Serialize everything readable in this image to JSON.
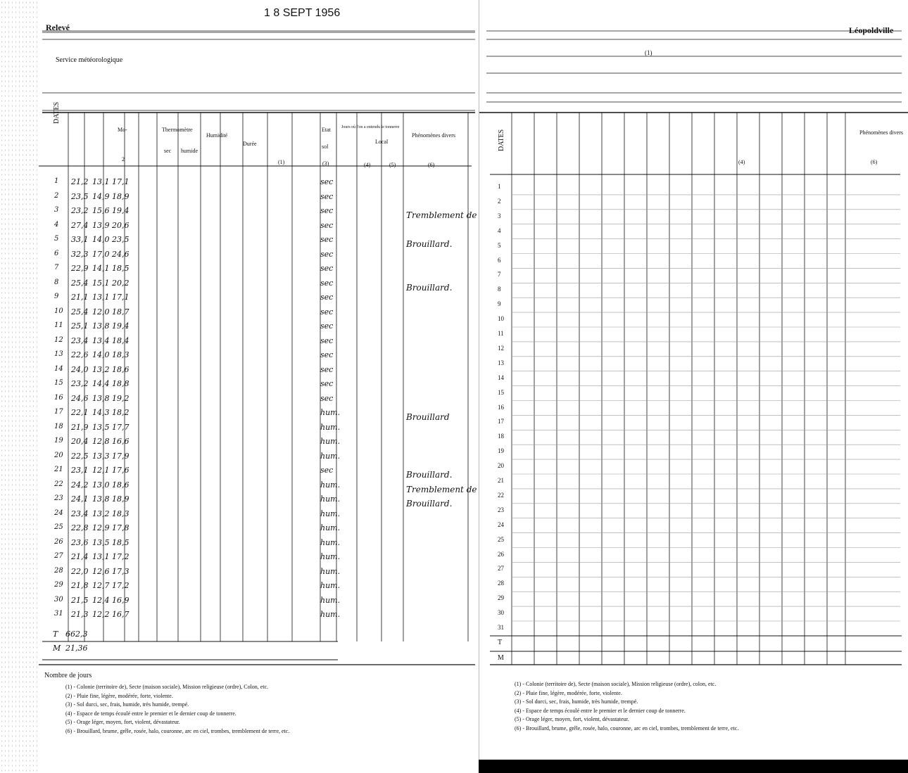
{
  "stamp_date": "1 8 SEPT 1956",
  "left_page": {
    "title_fragment": "Relevé",
    "subtitle_fragment": "Service météorologique",
    "columns": {
      "dates": "DATES",
      "moyenne": "Mo-",
      "thermometre": "Thermomètre",
      "sec": "sec",
      "humide": "humide",
      "humidite": "Humidité",
      "duree": "Durée",
      "brouillard": "Etat",
      "sol": "sol",
      "jours": "Jours où l'on a entendu le tonnerre",
      "local": "Local",
      "phenomenes": "Phénomènes divers",
      "n1": "(1)",
      "n2": "2",
      "n3": "(3)",
      "n4": "(4)",
      "n5": "(5)",
      "n6": "(6)"
    },
    "rows": [
      {
        "day": "1",
        "a": "21,2",
        "b": "13,1",
        "c": "17,1",
        "sol": "sec"
      },
      {
        "day": "2",
        "a": "23,5",
        "b": "14,9",
        "c": "18,9",
        "sol": "sec"
      },
      {
        "day": "3",
        "a": "23,2",
        "b": "15,6",
        "c": "19,4",
        "sol": "sec"
      },
      {
        "day": "4",
        "a": "27,4",
        "b": "13,9",
        "c": "20,6",
        "sol": "sec"
      },
      {
        "day": "5",
        "a": "33,1",
        "b": "14,0",
        "c": "23,5",
        "sol": "sec"
      },
      {
        "day": "6",
        "a": "32,3",
        "b": "17,0",
        "c": "24,6",
        "sol": "sec"
      },
      {
        "day": "7",
        "a": "22,9",
        "b": "14,1",
        "c": "18,5",
        "sol": "sec"
      },
      {
        "day": "8",
        "a": "25,4",
        "b": "15,1",
        "c": "20,2",
        "sol": "sec"
      },
      {
        "day": "9",
        "a": "21,1",
        "b": "13,1",
        "c": "17,1",
        "sol": "sec"
      },
      {
        "day": "10",
        "a": "25,4",
        "b": "12,0",
        "c": "18,7",
        "sol": "sec"
      },
      {
        "day": "11",
        "a": "25,1",
        "b": "13,8",
        "c": "19,4",
        "sol": "sec"
      },
      {
        "day": "12",
        "a": "23,4",
        "b": "13,4",
        "c": "18,4",
        "sol": "sec"
      },
      {
        "day": "13",
        "a": "22,6",
        "b": "14,0",
        "c": "18,3",
        "sol": "sec"
      },
      {
        "day": "14",
        "a": "24,0",
        "b": "13,2",
        "c": "18,6",
        "sol": "sec"
      },
      {
        "day": "15",
        "a": "23,2",
        "b": "14,4",
        "c": "18,8",
        "sol": "sec"
      },
      {
        "day": "16",
        "a": "24,6",
        "b": "13,8",
        "c": "19,2",
        "sol": "sec"
      },
      {
        "day": "17",
        "a": "22,1",
        "b": "14,3",
        "c": "18,2",
        "sol": "hum."
      },
      {
        "day": "18",
        "a": "21,9",
        "b": "13,5",
        "c": "17,7",
        "sol": "hum."
      },
      {
        "day": "19",
        "a": "20,4",
        "b": "12,8",
        "c": "16,6",
        "sol": "hum."
      },
      {
        "day": "20",
        "a": "22,5",
        "b": "13,3",
        "c": "17,9",
        "sol": "hum."
      },
      {
        "day": "21",
        "a": "23,1",
        "b": "12,1",
        "c": "17,6",
        "sol": "sec"
      },
      {
        "day": "22",
        "a": "24,2",
        "b": "13,0",
        "c": "18,6",
        "sol": "hum."
      },
      {
        "day": "23",
        "a": "24,1",
        "b": "13,8",
        "c": "18,9",
        "sol": "hum."
      },
      {
        "day": "24",
        "a": "23,4",
        "b": "13,2",
        "c": "18,3",
        "sol": "hum."
      },
      {
        "day": "25",
        "a": "22,8",
        "b": "12,9",
        "c": "17,8",
        "sol": "hum."
      },
      {
        "day": "26",
        "a": "23,6",
        "b": "13,5",
        "c": "18,5",
        "sol": "hum."
      },
      {
        "day": "27",
        "a": "21,4",
        "b": "13,1",
        "c": "17,2",
        "sol": "hum."
      },
      {
        "day": "28",
        "a": "22,0",
        "b": "12,6",
        "c": "17,3",
        "sol": "hum."
      },
      {
        "day": "29",
        "a": "21,8",
        "b": "12,7",
        "c": "17,2",
        "sol": "hum."
      },
      {
        "day": "30",
        "a": "21,5",
        "b": "12,4",
        "c": "16,9",
        "sol": "hum."
      },
      {
        "day": "31",
        "a": "21,3",
        "b": "12,2",
        "c": "16,7",
        "sol": "hum."
      }
    ],
    "totals": {
      "t_label": "T",
      "t": "662,3",
      "m_label": "M",
      "m": "21,36"
    },
    "phenomena": [
      {
        "day": "3",
        "text": "Tremblement de terre"
      },
      {
        "day": "5",
        "text": "Brouillard."
      },
      {
        "day": "8",
        "text": "Brouillard."
      },
      {
        "day": "17",
        "text": "Brouillard"
      },
      {
        "day": "21",
        "text": "Brouillard."
      },
      {
        "day": "22",
        "text": "Tremblement de terre"
      },
      {
        "day": "23",
        "text": "Brouillard."
      }
    ],
    "footer": {
      "nombre": "Nombre de jours",
      "notes": [
        "(1) - Colonie (territoire de), Secte (maison sociale), Mission religieuse (ordre), Colon, etc.",
        "(2) - Pluie fine, légère, modérée, forte, violente.",
        "(3) - Sol durci, sec, frais, humide, très humide, trempé.",
        "(4) - Espace de temps écoulé entre le premier et le dernier coup de tonnerre.",
        "(5) - Orage léger, moyen, fort, violent, dévastateur.",
        "(6) - Brouillard, brume, grêle, rosée, halo, couronne, arc en ciel, trombes, tremblement de terre, etc."
      ]
    }
  },
  "right_page": {
    "title_fragment": "Léopoldville",
    "header_ref": "(1)",
    "dates": "DATES",
    "phenomenes": "Phénomènes divers",
    "n4": "(4)",
    "n6": "(6)",
    "days": [
      "1",
      "2",
      "3",
      "4",
      "5",
      "6",
      "7",
      "8",
      "9",
      "10",
      "11",
      "12",
      "13",
      "14",
      "15",
      "16",
      "17",
      "18",
      "19",
      "20",
      "21",
      "22",
      "23",
      "24",
      "25",
      "26",
      "27",
      "28",
      "29",
      "30",
      "31"
    ],
    "totals": {
      "t": "T",
      "m": "M"
    },
    "footer": {
      "notes": [
        "(1) - Colonie (territoire de), Secte (maison sociale), Mission religieuse (ordre), colon, etc.",
        "(2) - Pluie fine, légère, modérée, forte, violente.",
        "(3) - Sol durci, sec, frais, humide, très humide, trempé.",
        "(4) - Espace de temps écoulé entre le premier et le dernier coup de tonnerre.",
        "(5) - Orage léger, moyen, fort, violent, dévastateur.",
        "(6) - Brouillard, brume, grêle, rosée, halo, couronne, arc en ciel, trombes, tremblement de terre, etc."
      ]
    }
  },
  "colors": {
    "ink": "#111111",
    "paper": "#ffffff",
    "rule": "#9a9a9a"
  }
}
